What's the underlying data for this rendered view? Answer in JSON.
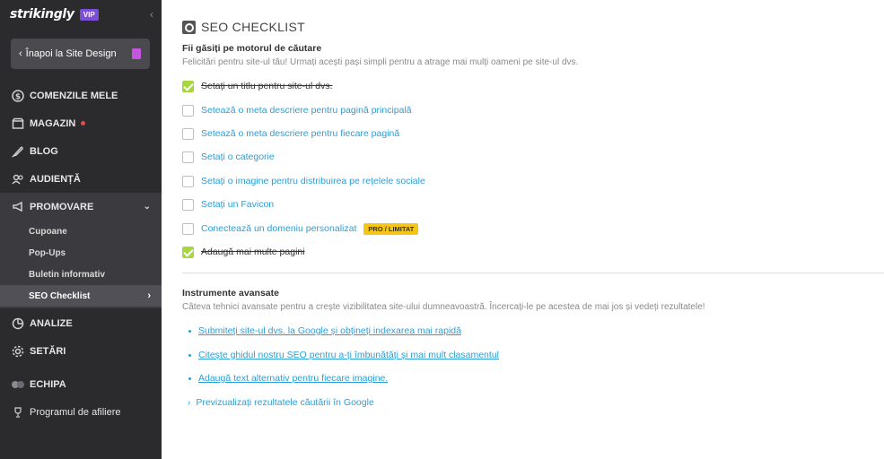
{
  "brand": {
    "logo": "strikingly",
    "vip": "VIP"
  },
  "sidebar": {
    "back_label": "Înapoi la Site Design",
    "items": [
      {
        "label": "COMENZILE MELE",
        "icon": "dollar-circle-icon"
      },
      {
        "label": "MAGAZIN",
        "icon": "store-icon"
      },
      {
        "label": "BLOG",
        "icon": "feather-icon"
      },
      {
        "label": "AUDIENȚĂ",
        "icon": "users-icon"
      },
      {
        "label": "PROMOVARE",
        "icon": "megaphone-icon"
      },
      {
        "label": "ANALIZE",
        "icon": "pie-chart-icon"
      },
      {
        "label": "SETĂRI",
        "icon": "gear-icon"
      },
      {
        "label": "ECHIPA",
        "icon": "team-icon"
      },
      {
        "label": "Programul de afiliere",
        "icon": "trophy-icon"
      }
    ],
    "sub_items": [
      {
        "label": "Cupoane"
      },
      {
        "label": "Pop-Ups"
      },
      {
        "label": "Buletin informativ"
      },
      {
        "label": "SEO Checklist"
      }
    ]
  },
  "main": {
    "title": "SEO CHECKLIST",
    "search_heading": "Fii găsiți pe motorul de căutare",
    "search_desc": "Felicitări pentru site-ul tău! Urmați acești pași simpli pentru a atrage mai mulți oameni pe site-ul dvs.",
    "checklist": [
      {
        "label": "Setați un titlu pentru site-ul dvs.",
        "done": true
      },
      {
        "label": "Setează o meta descriere pentru pagină principală",
        "done": false
      },
      {
        "label": "Setează o meta descriere pentru fiecare pagină",
        "done": false
      },
      {
        "label": "Setați o categorie",
        "done": false
      },
      {
        "label": "Setați o imagine pentru distribuirea pe rețelele sociale",
        "done": false
      },
      {
        "label": "Setați un Favicon",
        "done": false
      },
      {
        "label": "Conectează un domeniu personalizat",
        "done": false,
        "badge": "PRO / LIMITAT"
      },
      {
        "label": "Adaugă mai multe pagini",
        "done": true
      }
    ],
    "advanced_heading": "Instrumente avansate",
    "advanced_desc": "Câteva tehnici avansate pentru a crește vizibilitatea site-ului dumneavoastră. Încercați-le pe acestea de mai jos și vedeți rezultatele!",
    "links": [
      "Submiteți site-ul dvs. la Google și obțineți indexarea mai rapidă",
      "Citește ghidul nostru SEO pentru a-ți îmbunătăți și mai mult clasamentul",
      "Adaugă text alternativ pentru fiecare imagine."
    ],
    "preview_label": "Previzualizați rezultatele căutării în Google"
  },
  "colors": {
    "sidebar_bg": "#2b2b2e",
    "accent_link": "#2a9fd6",
    "check_green": "#a6d640",
    "badge_yellow": "#f5c518",
    "vip_purple": "#7a4fd6"
  }
}
